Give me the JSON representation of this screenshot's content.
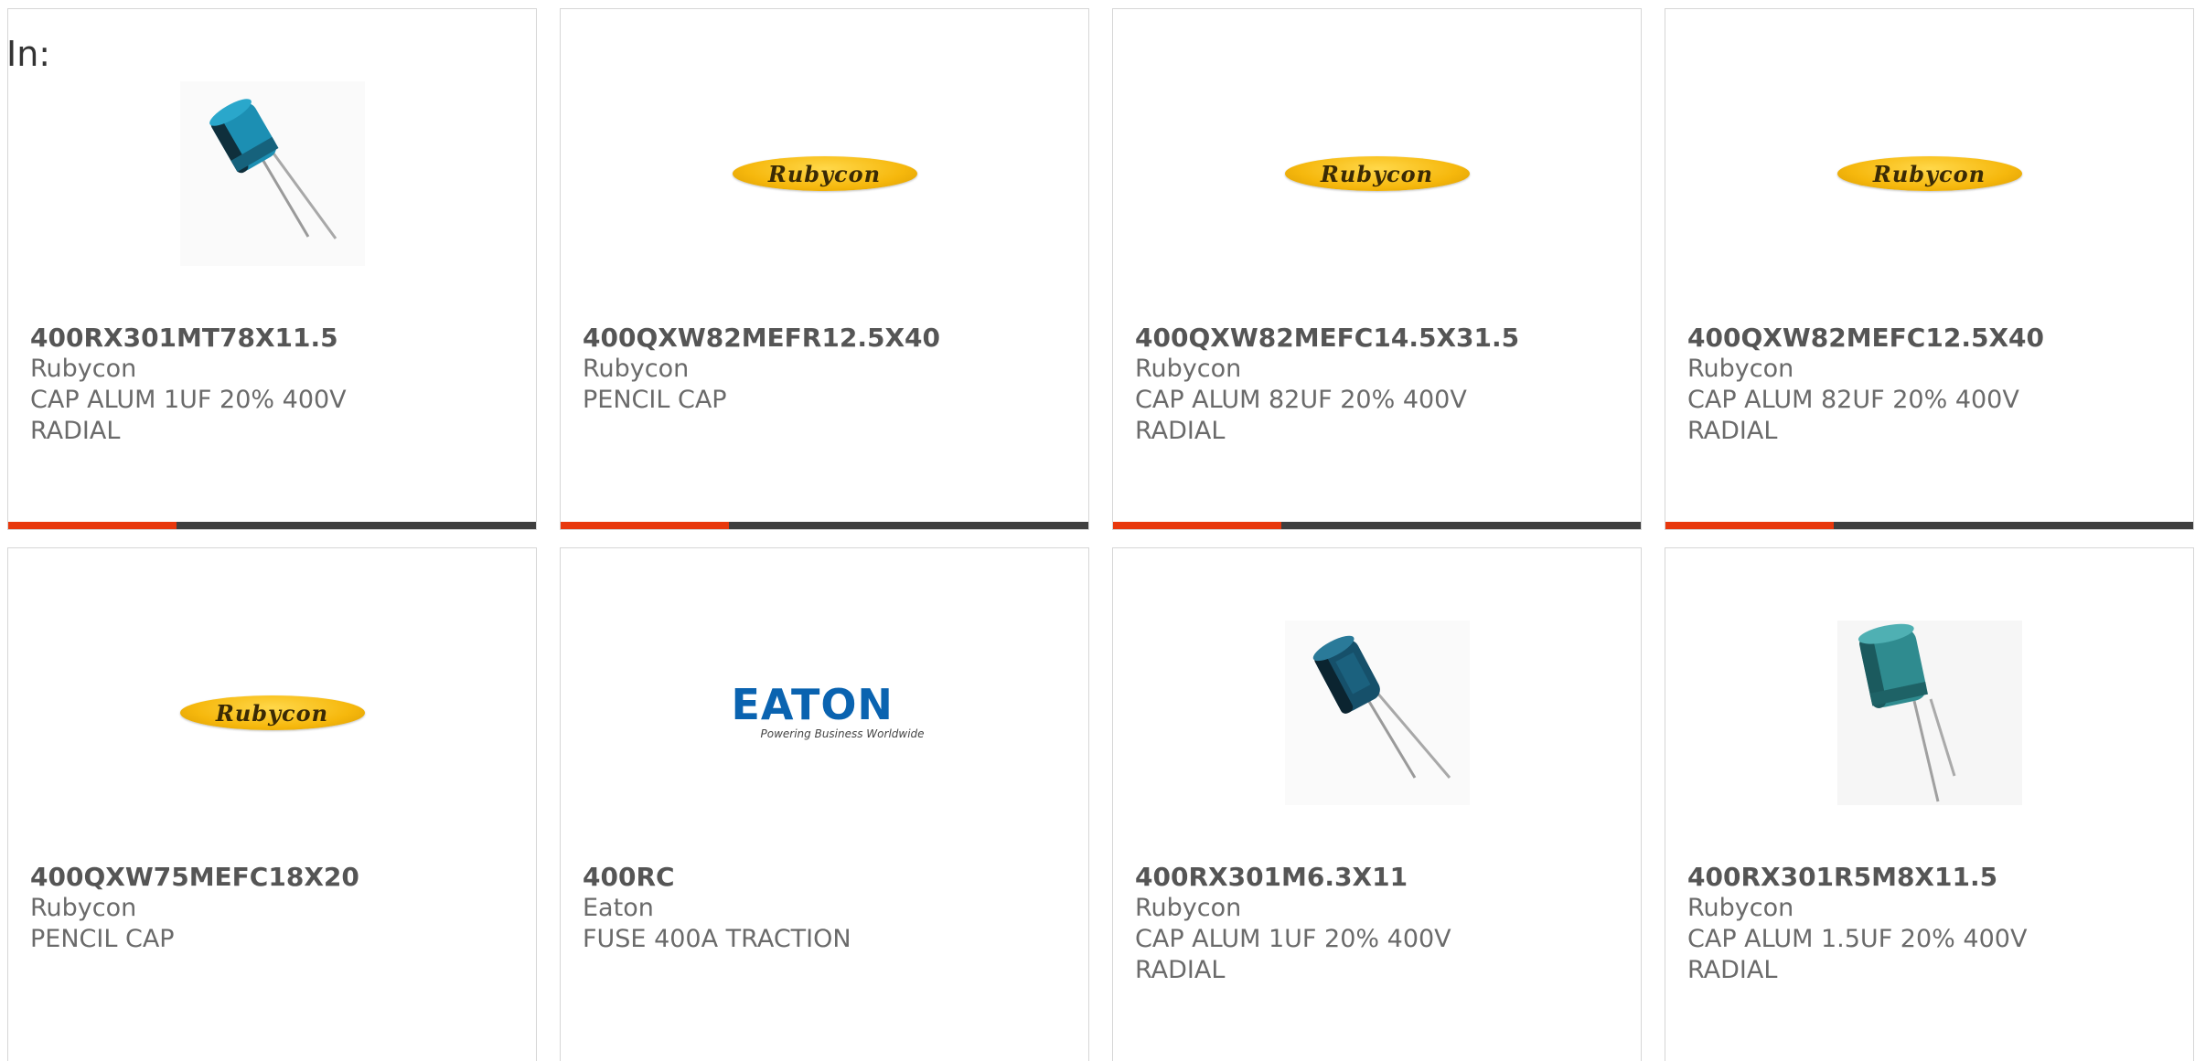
{
  "header": {
    "in_label": "In:"
  },
  "products": [
    {
      "part_number": "400RX301MT78X11.5",
      "manufacturer": "Rubycon",
      "description": "CAP ALUM 1UF 20% 400V",
      "description2": "RADIAL",
      "image": "capacitor-photo"
    },
    {
      "part_number": "400QXW82MEFR12.5X40",
      "manufacturer": "Rubycon",
      "description": "PENCIL CAP",
      "description2": "",
      "image": "rubycon-logo",
      "logo_text": "Rubycon"
    },
    {
      "part_number": "400QXW82MEFC14.5X31.5",
      "manufacturer": "Rubycon",
      "description": "CAP ALUM 82UF 20% 400V",
      "description2": "RADIAL",
      "image": "rubycon-logo",
      "logo_text": "Rubycon"
    },
    {
      "part_number": "400QXW82MEFC12.5X40",
      "manufacturer": "Rubycon",
      "description": "CAP ALUM 82UF 20% 400V",
      "description2": "RADIAL",
      "image": "rubycon-logo",
      "logo_text": "Rubycon"
    },
    {
      "part_number": "400QXW75MEFC18X20",
      "manufacturer": "Rubycon",
      "description": "PENCIL CAP",
      "description2": "",
      "image": "rubycon-logo",
      "logo_text": "Rubycon"
    },
    {
      "part_number": "400RC",
      "manufacturer": "Eaton",
      "description": "FUSE 400A TRACTION",
      "description2": "",
      "image": "eaton-logo",
      "logo_text": "EATON",
      "logo_tagline": "Powering Business Worldwide"
    },
    {
      "part_number": "400RX301M6.3X11",
      "manufacturer": "Rubycon",
      "description": "CAP ALUM 1UF 20% 400V",
      "description2": "RADIAL",
      "image": "capacitor-photo"
    },
    {
      "part_number": "400RX301R5M8X11.5",
      "manufacturer": "Rubycon",
      "description": "CAP ALUM 1.5UF 20% 400V",
      "description2": "RADIAL",
      "image": "capacitor-photo-teal"
    }
  ],
  "colors": {
    "accent": "#e8380d",
    "bar": "#3f3f3f",
    "border": "#d6d6d6",
    "text": "#6a6a6a"
  }
}
